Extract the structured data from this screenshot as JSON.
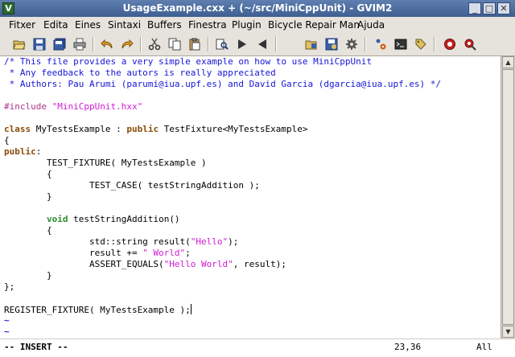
{
  "window": {
    "title": "UsageExample.cxx + (~/src/MiniCppUnit) - GVIM2",
    "icon": "vim-icon",
    "controls": [
      "minimize-icon",
      "maximize-icon",
      "close-icon"
    ],
    "minimize_glyph": "_",
    "maximize_glyph": "□",
    "close_glyph": "✕"
  },
  "menubar": {
    "items": [
      "Fitxer",
      "Edita",
      "Eines",
      "Sintaxi",
      "Buffers",
      "Finestra",
      "Plugin",
      "Bicycle Repair Man",
      "Ajuda"
    ]
  },
  "toolbar": {
    "buttons": [
      "open-icon",
      "save-icon",
      "save-all-icon",
      "print-icon",
      "undo-icon",
      "redo-icon",
      "cut-icon",
      "copy-icon",
      "paste-icon",
      "find-replace-icon",
      "find-next-icon",
      "find-prev-icon",
      "load-session-icon",
      "save-session-icon",
      "run-script-icon",
      "make-icon",
      "shell-icon",
      "tags-icon",
      "help-icon",
      "find-help-icon"
    ]
  },
  "editor": {
    "lines": [
      {
        "segments": [
          {
            "text": "/* This file provides a very simple example on how to use MiniCppUnit",
            "cls": "cmt"
          }
        ]
      },
      {
        "segments": [
          {
            "text": " * Any feedback to the autors is really appreciated",
            "cls": "cmt"
          }
        ]
      },
      {
        "segments": [
          {
            "text": " * Authors: Pau Arumi (parumi@iua.upf.es) and David Garcia (dgarcia@iua.upf.es) */",
            "cls": "cmt"
          }
        ]
      },
      {
        "segments": []
      },
      {
        "segments": [
          {
            "text": "#include ",
            "cls": "pre"
          },
          {
            "text": "\"MiniCppUnit.hxx\"",
            "cls": "str"
          }
        ]
      },
      {
        "segments": []
      },
      {
        "segments": [
          {
            "text": "class",
            "cls": "kw"
          },
          {
            "text": " MyTestsExample : ",
            "cls": ""
          },
          {
            "text": "public",
            "cls": "kw"
          },
          {
            "text": " TestFixture<MyTestsExample>",
            "cls": ""
          }
        ]
      },
      {
        "segments": [
          {
            "text": "{",
            "cls": ""
          }
        ]
      },
      {
        "segments": [
          {
            "text": "public",
            "cls": "kw"
          },
          {
            "text": ":",
            "cls": ""
          }
        ]
      },
      {
        "segments": [
          {
            "text": "        TEST_FIXTURE( MyTestsExample )",
            "cls": ""
          }
        ]
      },
      {
        "segments": [
          {
            "text": "        {",
            "cls": ""
          }
        ]
      },
      {
        "segments": [
          {
            "text": "                TEST_CASE( testStringAddition );",
            "cls": ""
          }
        ]
      },
      {
        "segments": [
          {
            "text": "        }",
            "cls": ""
          }
        ]
      },
      {
        "segments": []
      },
      {
        "segments": [
          {
            "text": "        ",
            "cls": ""
          },
          {
            "text": "void",
            "cls": "ty"
          },
          {
            "text": " testStringAddition()",
            "cls": ""
          }
        ]
      },
      {
        "segments": [
          {
            "text": "        {",
            "cls": ""
          }
        ]
      },
      {
        "segments": [
          {
            "text": "                std::string result(",
            "cls": ""
          },
          {
            "text": "\"Hello\"",
            "cls": "str"
          },
          {
            "text": ");",
            "cls": ""
          }
        ]
      },
      {
        "segments": [
          {
            "text": "                result += ",
            "cls": ""
          },
          {
            "text": "\" World\"",
            "cls": "str"
          },
          {
            "text": ";",
            "cls": ""
          }
        ]
      },
      {
        "segments": [
          {
            "text": "                ASSERT_EQUALS(",
            "cls": ""
          },
          {
            "text": "\"Hello World\"",
            "cls": "str"
          },
          {
            "text": ", result);",
            "cls": ""
          }
        ]
      },
      {
        "segments": [
          {
            "text": "        }",
            "cls": ""
          }
        ]
      },
      {
        "segments": [
          {
            "text": "};",
            "cls": ""
          }
        ]
      },
      {
        "segments": []
      },
      {
        "segments": [
          {
            "text": "REGISTER_FIXTURE( MyTestsExample );",
            "cls": ""
          }
        ],
        "cursor": true
      },
      {
        "segments": [
          {
            "text": "~",
            "cls": "tilde"
          }
        ]
      },
      {
        "segments": [
          {
            "text": "~",
            "cls": "tilde"
          }
        ]
      },
      {
        "segments": [
          {
            "text": "~",
            "cls": "tilde"
          }
        ]
      }
    ]
  },
  "statusbar": {
    "mode": "-- INSERT --",
    "position": "23,36",
    "scroll": "All"
  }
}
